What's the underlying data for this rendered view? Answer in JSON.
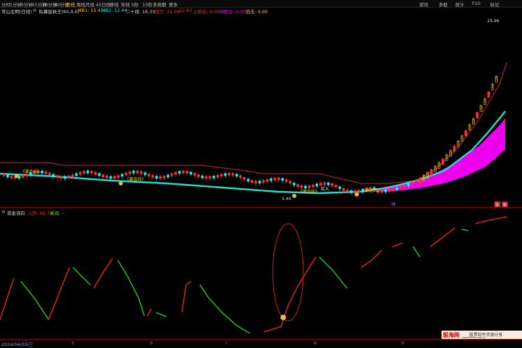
{
  "toolbar": {
    "items": [
      "分时",
      "1分钟",
      "5分钟",
      "15分钟",
      "30分钟",
      "60分钟",
      "日线",
      "周线",
      "月线",
      "45日线",
      "季线",
      "年线",
      "5秒",
      "15秒",
      "多周期",
      "更多"
    ],
    "active_index": 6,
    "right_items": [
      "资讯",
      "多股",
      "统计",
      "F10",
      "标记"
    ]
  },
  "infoline": {
    "stock": "常山北明(日线)",
    "formula": "私募捉妖王(60,0,0)",
    "mb1": "MB1: 15.41",
    "mb2": "MB2: 12.44",
    "ma20": "二十线: 16.33",
    "resistance": "压力: 21.09",
    "ref_label": "22.63",
    "stop": "止损位: 0.00",
    "hold": "持股位: 0.00",
    "chase": "追击: 0.00"
  },
  "price_chart": {
    "high_label": "25.96",
    "low_label": "5.40",
    "markers": [
      "黄金线",
      "黄金线",
      "黄金线",
      "黄金线",
      "买入"
    ],
    "badge_left": "财",
    "badge_right1": "涨",
    "badge_right2": "周"
  },
  "indicator": {
    "name": "资金流向",
    "up_label": "上升: 92.74",
    "down_label": "衰弱: -"
  },
  "x_axis": {
    "date": "2024/04/03/三",
    "ticks": [
      "5",
      "6",
      "7",
      "8",
      "9"
    ]
  },
  "colors": {
    "up": "#ff3333",
    "down": "#00ffff",
    "gold": "#ffcc00",
    "magenta": "#ff00ff",
    "line_red": "#ff2222",
    "line_green": "#22dd22"
  },
  "logo": {
    "main": "股海网",
    "sub": "股票软件资源分享",
    "url": "www.Guhai.com.cn"
  }
}
